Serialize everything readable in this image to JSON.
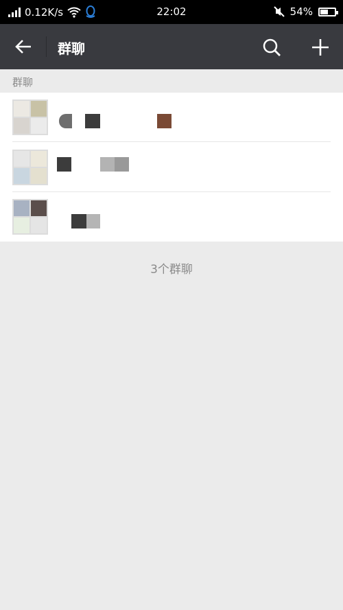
{
  "status_bar": {
    "net_speed": "0.12K/s",
    "time": "22:02",
    "battery_percent": "54%",
    "battery_level": 0.54
  },
  "header": {
    "title": "群聊",
    "back_icon": "arrow-left-icon",
    "search_icon": "search-icon",
    "add_icon": "plus-icon"
  },
  "section": {
    "label": "群聊"
  },
  "groups": [
    {
      "avatar_colors": [
        "#ece9e3",
        "#c8c2a6",
        "#d8d4cf",
        "#ebebeb"
      ],
      "name_blocks": [
        "#6e6e6e",
        "#3c3c3c",
        "#7a4a35"
      ]
    },
    {
      "avatar_colors": [
        "#e6e6e6",
        "#ece8db",
        "#c9d6e0",
        "#e4e0cf"
      ],
      "name_blocks": [
        "#3c3c3c",
        "#b3b3b3",
        "#999999"
      ]
    },
    {
      "avatar_colors": [
        "#a8b2c2",
        "#5b4e4b",
        "#e7efe1",
        "#e5e5e5"
      ],
      "name_blocks": [
        "#3c3c3c",
        "#b5b5b5"
      ]
    }
  ],
  "footer": {
    "count_text": "3个群聊"
  }
}
